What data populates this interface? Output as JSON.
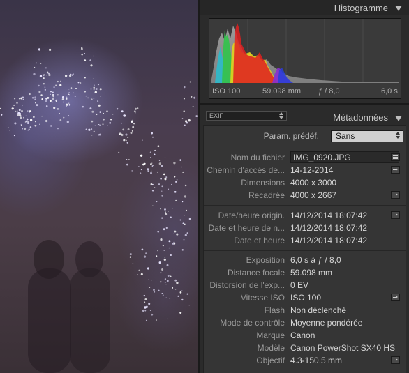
{
  "histogram": {
    "title": "Histogramme",
    "iso": "ISO 100",
    "focal": "59.098 mm",
    "aperture": "ƒ / 8,0",
    "shutter": "6,0 s"
  },
  "metadata": {
    "title": "Métadonnées",
    "view_select": "EXIF",
    "preset_label": "Param. prédéf.",
    "preset_value": "Sans",
    "rows": [
      {
        "label": "Nom du fichier",
        "value": "IMG_0920.JPG"
      },
      {
        "label": "Chemin d'accès de...",
        "value": "14-12-2014"
      },
      {
        "label": "Dimensions",
        "value": "4000 x 3000"
      },
      {
        "label": "Recadrée",
        "value": "4000 x 2667"
      },
      {
        "label": "Date/heure origin.",
        "value": "14/12/2014 18:07:42"
      },
      {
        "label": "Date et heure de n...",
        "value": "14/12/2014 18:07:42"
      },
      {
        "label": "Date et heure",
        "value": "14/12/2014 18:07:42"
      },
      {
        "label": "Exposition",
        "value": "6,0 s à ƒ / 8,0"
      },
      {
        "label": "Distance focale",
        "value": "59.098 mm"
      },
      {
        "label": "Distorsion de l'exp...",
        "value": "0 EV"
      },
      {
        "label": "Vitesse ISO",
        "value": "ISO 100"
      },
      {
        "label": "Flash",
        "value": "Non déclenché"
      },
      {
        "label": "Mode de contrôle",
        "value": "Moyenne pondérée"
      },
      {
        "label": "Marque",
        "value": "Canon"
      },
      {
        "label": "Modèle",
        "value": "Canon PowerShot SX40 HS"
      },
      {
        "label": "Objectif",
        "value": "4.3-150.5 mm"
      }
    ]
  },
  "icons": {
    "panel_collapse": "triangle-down-icon",
    "go_to": "arrow-right-icon",
    "list": "list-icon",
    "select": "updown-icon"
  }
}
